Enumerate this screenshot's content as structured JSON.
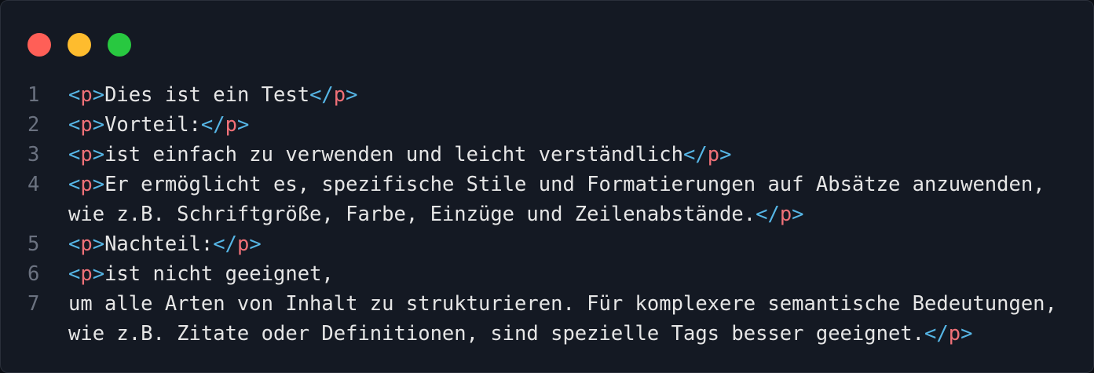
{
  "window": {
    "controls": [
      {
        "name": "close",
        "color": "#ff5f57"
      },
      {
        "name": "minimize",
        "color": "#febc2e"
      },
      {
        "name": "maximize",
        "color": "#28c840"
      }
    ]
  },
  "colors": {
    "background": "#141923",
    "bracket": "#56b6e6",
    "tag_name": "#f07178",
    "text": "#e6e6e6",
    "line_number": "#6b7280"
  },
  "code": {
    "language": "html",
    "lines": [
      {
        "number": "1",
        "visual_lines": [
          [
            {
              "t": "bracket",
              "v": "<"
            },
            {
              "t": "tagname",
              "v": "p"
            },
            {
              "t": "bracket",
              "v": ">"
            },
            {
              "t": "txt",
              "v": "Dies ist ein Test"
            },
            {
              "t": "bracket",
              "v": "</"
            },
            {
              "t": "tagname",
              "v": "p"
            },
            {
              "t": "bracket",
              "v": ">"
            }
          ]
        ]
      },
      {
        "number": "2",
        "visual_lines": [
          [
            {
              "t": "bracket",
              "v": "<"
            },
            {
              "t": "tagname",
              "v": "p"
            },
            {
              "t": "bracket",
              "v": ">"
            },
            {
              "t": "txt",
              "v": "Vorteil:"
            },
            {
              "t": "bracket",
              "v": "</"
            },
            {
              "t": "tagname",
              "v": "p"
            },
            {
              "t": "bracket",
              "v": ">"
            }
          ]
        ]
      },
      {
        "number": "3",
        "visual_lines": [
          [
            {
              "t": "bracket",
              "v": "<"
            },
            {
              "t": "tagname",
              "v": "p"
            },
            {
              "t": "bracket",
              "v": ">"
            },
            {
              "t": "txt",
              "v": "ist einfach zu verwenden und leicht verständlich"
            },
            {
              "t": "bracket",
              "v": "</"
            },
            {
              "t": "tagname",
              "v": "p"
            },
            {
              "t": "bracket",
              "v": ">"
            }
          ]
        ]
      },
      {
        "number": "4",
        "visual_lines": [
          [
            {
              "t": "bracket",
              "v": "<"
            },
            {
              "t": "tagname",
              "v": "p"
            },
            {
              "t": "bracket",
              "v": ">"
            },
            {
              "t": "txt",
              "v": "Er ermöglicht es, spezifische Stile und Formatierungen auf Absätze anzuwenden,"
            }
          ],
          [
            {
              "t": "txt",
              "v": "wie z.B. Schriftgröße, Farbe, Einzüge und Zeilenabstände."
            },
            {
              "t": "bracket",
              "v": "</"
            },
            {
              "t": "tagname",
              "v": "p"
            },
            {
              "t": "bracket",
              "v": ">"
            }
          ]
        ]
      },
      {
        "number": "5",
        "visual_lines": [
          [
            {
              "t": "bracket",
              "v": "<"
            },
            {
              "t": "tagname",
              "v": "p"
            },
            {
              "t": "bracket",
              "v": ">"
            },
            {
              "t": "txt",
              "v": "Nachteil:"
            },
            {
              "t": "bracket",
              "v": "</"
            },
            {
              "t": "tagname",
              "v": "p"
            },
            {
              "t": "bracket",
              "v": ">"
            }
          ]
        ]
      },
      {
        "number": "6",
        "visual_lines": [
          [
            {
              "t": "bracket",
              "v": "<"
            },
            {
              "t": "tagname",
              "v": "p"
            },
            {
              "t": "bracket",
              "v": ">"
            },
            {
              "t": "txt",
              "v": "ist nicht geeignet,"
            }
          ]
        ]
      },
      {
        "number": "7",
        "visual_lines": [
          [
            {
              "t": "txt",
              "v": "um alle Arten von Inhalt zu strukturieren. Für komplexere semantische Bedeutungen,"
            }
          ],
          [
            {
              "t": "txt",
              "v": "wie z.B. Zitate oder Definitionen, sind spezielle Tags besser geeignet."
            },
            {
              "t": "bracket",
              "v": "</"
            },
            {
              "t": "tagname",
              "v": "p"
            },
            {
              "t": "bracket",
              "v": ">"
            }
          ]
        ]
      }
    ]
  }
}
